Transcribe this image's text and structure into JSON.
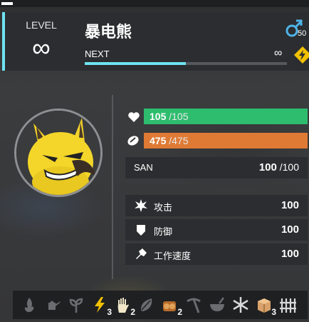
{
  "level": {
    "label": "LEVEL",
    "value": "∞"
  },
  "pal": {
    "name": "暴电熊",
    "gender_level": "50"
  },
  "next": {
    "label": "NEXT",
    "value": "∞",
    "progress": 0.5
  },
  "hp": {
    "current": "105",
    "max": " /105"
  },
  "stamina": {
    "current": "475",
    "max": " /475"
  },
  "san": {
    "label": "SAN",
    "current": "100",
    "max": " /100"
  },
  "stats": [
    {
      "icon": "attack-icon",
      "label": "攻击",
      "value": "100"
    },
    {
      "icon": "defense-icon",
      "label": "防御",
      "value": "100"
    },
    {
      "icon": "work-speed-icon",
      "label": "工作速度",
      "value": "100"
    }
  ],
  "work_skills": [
    {
      "icon": "kindling-icon",
      "level": ""
    },
    {
      "icon": "watering-icon",
      "level": ""
    },
    {
      "icon": "planting-icon",
      "level": ""
    },
    {
      "icon": "electricity-icon",
      "level": "3"
    },
    {
      "icon": "handiwork-icon",
      "level": "2"
    },
    {
      "icon": "gathering-icon",
      "level": ""
    },
    {
      "icon": "lumbering-icon",
      "level": "2"
    },
    {
      "icon": "mining-icon",
      "level": ""
    },
    {
      "icon": "medicine-icon",
      "level": ""
    },
    {
      "icon": "cooling-icon",
      "level": ""
    },
    {
      "icon": "transporting-icon",
      "level": "3"
    },
    {
      "icon": "farming-icon",
      "level": ""
    }
  ],
  "colors": {
    "accent": "#6fe3f0",
    "hp": "#2ebd6e",
    "stamina": "#df7a34",
    "electric": "#f2c100"
  }
}
